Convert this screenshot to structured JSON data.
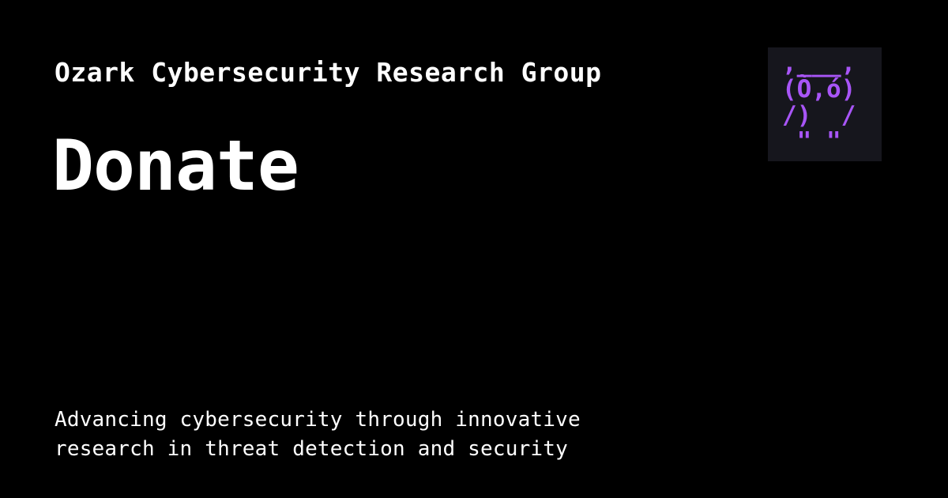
{
  "header": {
    "organization": "Ozark Cybersecurity Research Group",
    "title": "Donate"
  },
  "footer": {
    "tagline_line1": "Advancing cybersecurity through innovative",
    "tagline_line2": "research in threat detection and security"
  },
  "logo": {
    "icon": "owl-ascii-art-icon",
    "ascii_art": ",___,\n(Ò,ó)\n/)  /\n \" \"",
    "accent_color": "#a855f7",
    "background_color": "#16161d"
  },
  "theme": {
    "background": "#000000",
    "text": "#ffffff"
  }
}
